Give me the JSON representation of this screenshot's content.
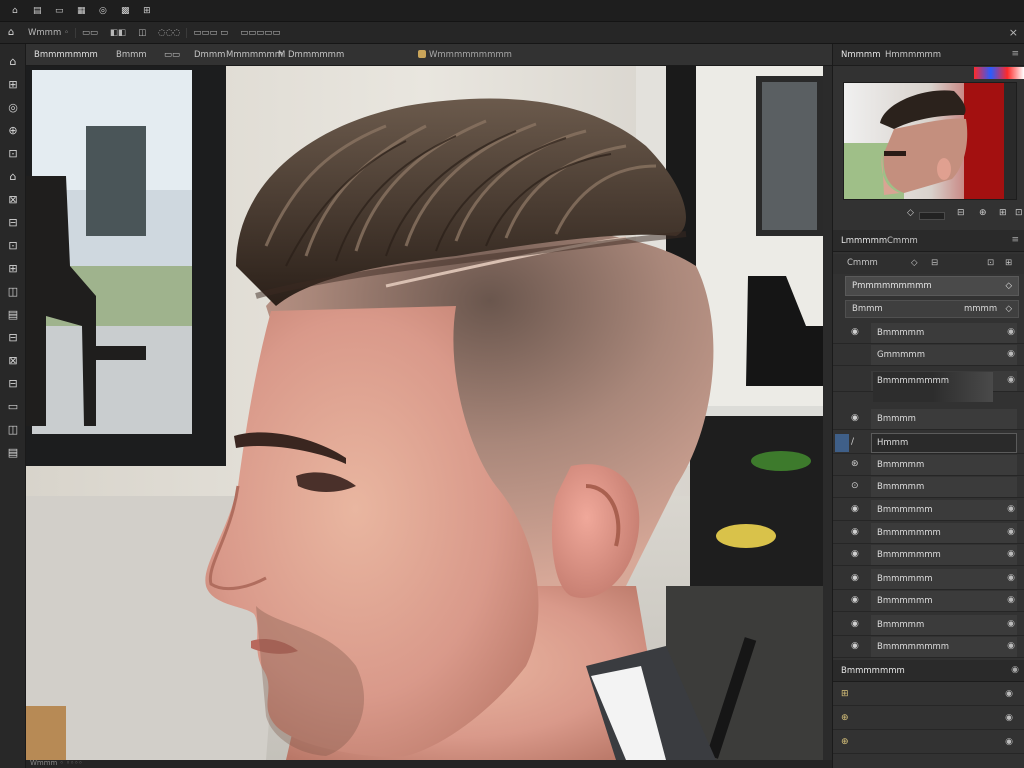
{
  "menubar": {
    "items": [
      "⌂",
      "▤",
      "▭",
      "▦",
      "◎",
      "▩",
      "⊞"
    ]
  },
  "optbar": {
    "home_icon": "⌂",
    "items": [
      "Wmmm ◦",
      "▭▭",
      "◧◧",
      "◫",
      "◌◌◌",
      "▭▭▭ ▭",
      "▭▭▭▭▭"
    ],
    "close": "×"
  },
  "document": {
    "tabs": [
      "Bmmmmmmm",
      "Bmmm",
      "▭▭",
      "Dmmm",
      "Mmmmmmm",
      "M",
      "Dmmmmmm"
    ],
    "center_tab": "Wmmmmmmmmm"
  },
  "toolbar": {
    "tools": [
      "move-tool",
      "marquee-tool",
      "lasso-tool",
      "quick-select-tool",
      "crop-tool",
      "eyedropper-tool",
      "healing-tool",
      "brush-tool",
      "clone-stamp-tool",
      "history-brush-tool",
      "eraser-tool",
      "gradient-tool",
      "blur-tool",
      "dodge-tool",
      "pen-tool",
      "type-tool",
      "path-select-tool",
      "shape-tool"
    ],
    "glyphs": [
      "⌂",
      "⊞",
      "◎",
      "⊕",
      "⊡",
      "⌂",
      "⊠",
      "⊟",
      "⊡",
      "⊞",
      "◫",
      "▤",
      "⊟",
      "⊠",
      "⊟",
      "▭",
      "◫",
      "▤"
    ]
  },
  "navigator": {
    "tabs": [
      "Nmmmm",
      "Hmmmmmm"
    ],
    "menu_icon": "≡",
    "controls": [
      "◇",
      "⊟",
      "⊕",
      "⊞",
      "⊡"
    ]
  },
  "layers": {
    "tabs": [
      "Lmmmmm",
      "Cmmm"
    ],
    "menu_icon": "≡",
    "tools": [
      "Cmmm",
      "◇",
      "⊟",
      "⊡",
      "⊞"
    ],
    "blend_mode": "Pmmmmmmmmm",
    "blend_icon": "◇",
    "opacity_label": "Bmmm",
    "opacity_value": "mmmm",
    "opacity_icon": "◇",
    "rows": [
      {
        "name": "Bmmmmm",
        "eye": "◉",
        "vis": "◉"
      },
      {
        "name": "Gmmmmm",
        "eye": "",
        "vis": "◉"
      },
      {
        "name": "Bmmmmmmmm",
        "eye": "",
        "vis": "◉"
      },
      {
        "name": "Bmmmm",
        "eye": "◉",
        "vis": ""
      },
      {
        "name": "Hmmm",
        "eye": "/",
        "vis": ""
      },
      {
        "name": "Bmmmmm",
        "eye": "⊛",
        "vis": ""
      },
      {
        "name": "Bmmmmm",
        "eye": "⊙",
        "vis": ""
      },
      {
        "name": "Bmmmmmm",
        "eye": "◉",
        "vis": "◉"
      },
      {
        "name": "Bmmmmmmm",
        "eye": "◉",
        "vis": "◉"
      },
      {
        "name": "Bmmmmmmm",
        "eye": "◉",
        "vis": "◉"
      },
      {
        "name": "Bmmmmmm",
        "eye": "◉",
        "vis": "◉"
      },
      {
        "name": "Bmmmmmm",
        "eye": "◉",
        "vis": "◉"
      },
      {
        "name": "Bmmmmm",
        "eye": "◉",
        "vis": "◉"
      },
      {
        "name": "Bmmmmmmmm",
        "eye": "◉",
        "vis": "◉"
      }
    ]
  },
  "adjustments": {
    "title": "Bmmmmmmm",
    "menu_icon": "◉",
    "rows": [
      {
        "icon": "⊞",
        "vis": "◉"
      },
      {
        "icon": "⊕",
        "vis": "◉"
      },
      {
        "icon": "⊕",
        "vis": "◉"
      }
    ]
  },
  "status": {
    "text": "Wmmm ◦ ◦◦◦◦"
  },
  "colors": {
    "bg_panel": "#323232",
    "accent": "#3f5f88"
  }
}
